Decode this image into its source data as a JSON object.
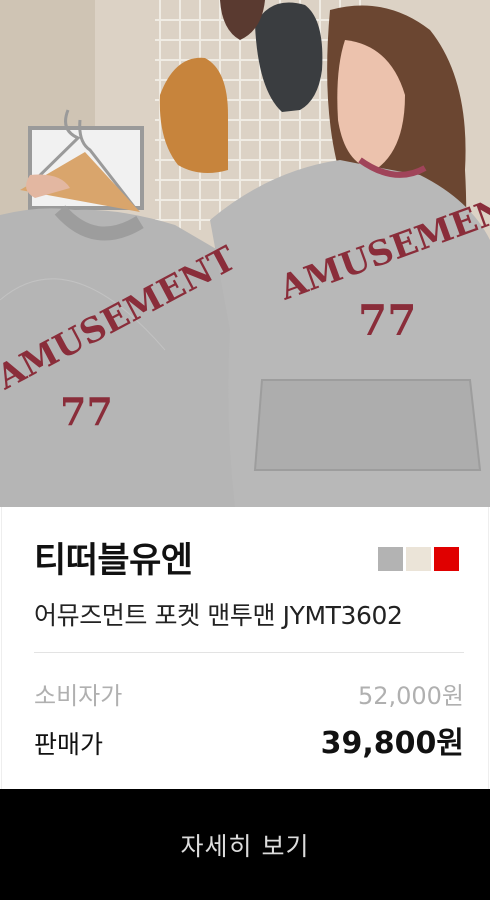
{
  "product_photo": {
    "description_icon": "product-photo",
    "print_text_left": "AMUSEMENT",
    "print_number_left": "77",
    "print_text_right": "AMUSEMENT",
    "print_number_right": "77"
  },
  "brand": "티떠블유엔",
  "color_swatches": [
    "#b3b3b3",
    "#ebe4d8",
    "#e00000"
  ],
  "product_name": "어뮤즈먼트 포켓 맨투맨 JYMT3602",
  "prices": {
    "msrp_label": "소비자가",
    "msrp_value": "52,000원",
    "sale_label": "판매가",
    "sale_value": "39,800원"
  },
  "detail_button_label": "자세히 보기"
}
